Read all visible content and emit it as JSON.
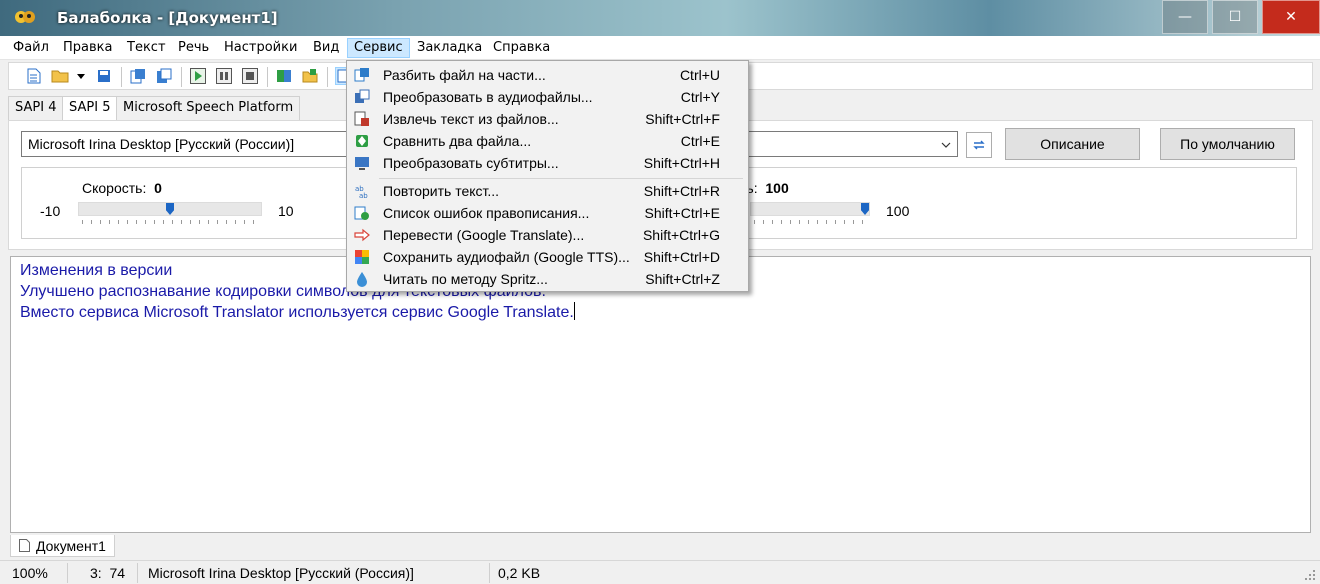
{
  "window": {
    "title": "Балаболка - [Документ1]",
    "minimize": "—",
    "maximize": "☐",
    "close": "✕"
  },
  "menu": {
    "items": [
      "Файл",
      "Правка",
      "Текст",
      "Речь",
      "Настройки",
      "Вид",
      "Сервис",
      "Закладка",
      "Справка"
    ],
    "active": "Сервис"
  },
  "engine_tabs": [
    "SAPI 4",
    "SAPI 5",
    "Microsoft Speech Platform"
  ],
  "voice": {
    "selected": "Microsoft Irina Desktop [Русский (России)]",
    "description_button": "Описание",
    "default_button": "По умолчанию"
  },
  "sliders": {
    "speed": {
      "label": "Скорость:",
      "value": "0",
      "min": "-10",
      "max": "10",
      "fraction": 0.5
    },
    "volume": {
      "label_partial": "ть:",
      "value": "100",
      "max": "100",
      "fraction": 1.0
    }
  },
  "editor": {
    "lines": [
      "Изменения в версии",
      "Улучшено распознавание кодировки символов для текстовых файлов.",
      "Вместо сервиса Microsoft Translator используется сервис Google Translate."
    ]
  },
  "document_tab": "Документ1",
  "status": {
    "zoom": "100%",
    "position": "3:  74",
    "voice": "Microsoft Irina Desktop [Русский (Россия)]",
    "size": "0,2 KB"
  },
  "service_menu": {
    "items": [
      {
        "label": "Разбить файл на части...",
        "shortcut": "Ctrl+U",
        "icon": "split-file-icon",
        "color": "#2d7cc9"
      },
      {
        "label": "Преобразовать в аудиофайлы...",
        "shortcut": "Ctrl+Y",
        "icon": "audio-convert-icon",
        "color": "#3b6fb6"
      },
      {
        "label": "Извлечь текст из файлов...",
        "shortcut": "Shift+Ctrl+F",
        "icon": "extract-text-icon",
        "color": "#c0392b"
      },
      {
        "label": "Сравнить два файла...",
        "shortcut": "Ctrl+E",
        "icon": "compare-files-icon",
        "color": "#2e9e44"
      },
      {
        "label": "Преобразовать субтитры...",
        "shortcut": "Shift+Ctrl+H",
        "icon": "subtitles-icon",
        "color": "#3a76c4"
      },
      {
        "label": "Повторить текст...",
        "shortcut": "Shift+Ctrl+R",
        "icon": "repeat-text-icon",
        "color": "#2d6fc0"
      },
      {
        "label": "Список ошибок правописания...",
        "shortcut": "Shift+Ctrl+E",
        "icon": "spelling-list-icon",
        "color": "#2d7cc9"
      },
      {
        "label": "Перевести (Google Translate)...",
        "shortcut": "Shift+Ctrl+G",
        "icon": "translate-icon",
        "color": "#d9443a"
      },
      {
        "label": "Сохранить аудиофайл (Google TTS)...",
        "shortcut": "Shift+Ctrl+D",
        "icon": "google-tts-icon",
        "color": "#34a853"
      },
      {
        "label": "Читать по методу Spritz...",
        "shortcut": "Shift+Ctrl+Z",
        "icon": "spritz-drop-icon",
        "color": "#3b8fd6"
      }
    ]
  }
}
